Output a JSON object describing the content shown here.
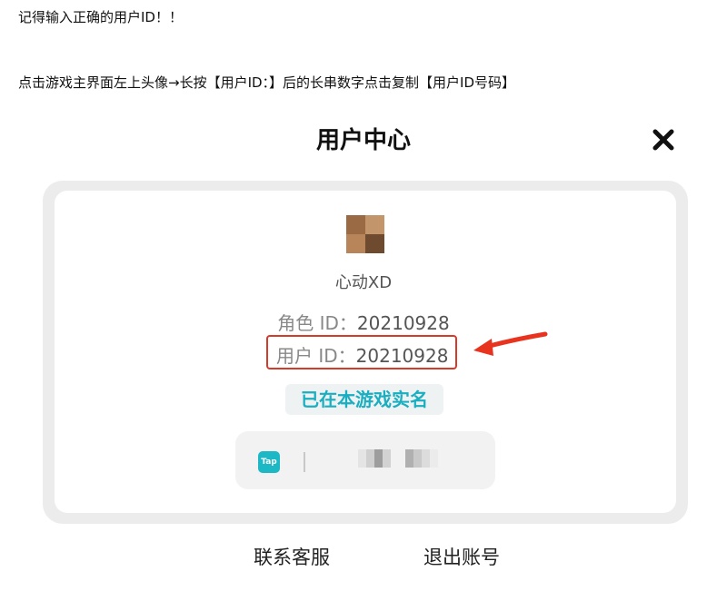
{
  "notes": {
    "line1": "记得输入正确的用户ID！！",
    "line2": "点击游戏主界面左上头像→长按【用户ID：】后的长串数字点击复制【用户ID号码】"
  },
  "header": {
    "title": "用户中心",
    "close_icon": "close-icon"
  },
  "profile": {
    "nickname": "心动XD",
    "role_id_label": "角色 ID：",
    "role_id_value": "20210928",
    "user_id_label": "用户 ID：",
    "user_id_value": "20210928",
    "verified_text": "已在本游戏实名"
  },
  "tap_account": {
    "logo_text": "Tap",
    "icon": "tap-logo-icon"
  },
  "footer": {
    "contact_label": "联系客服",
    "logout_label": "退出账号"
  },
  "colors": {
    "highlight_box": "#d83a2a",
    "annotation_arrow": "#e8331f",
    "verified_text": "#1aaec0",
    "tap_brand": "#1db8c6"
  }
}
